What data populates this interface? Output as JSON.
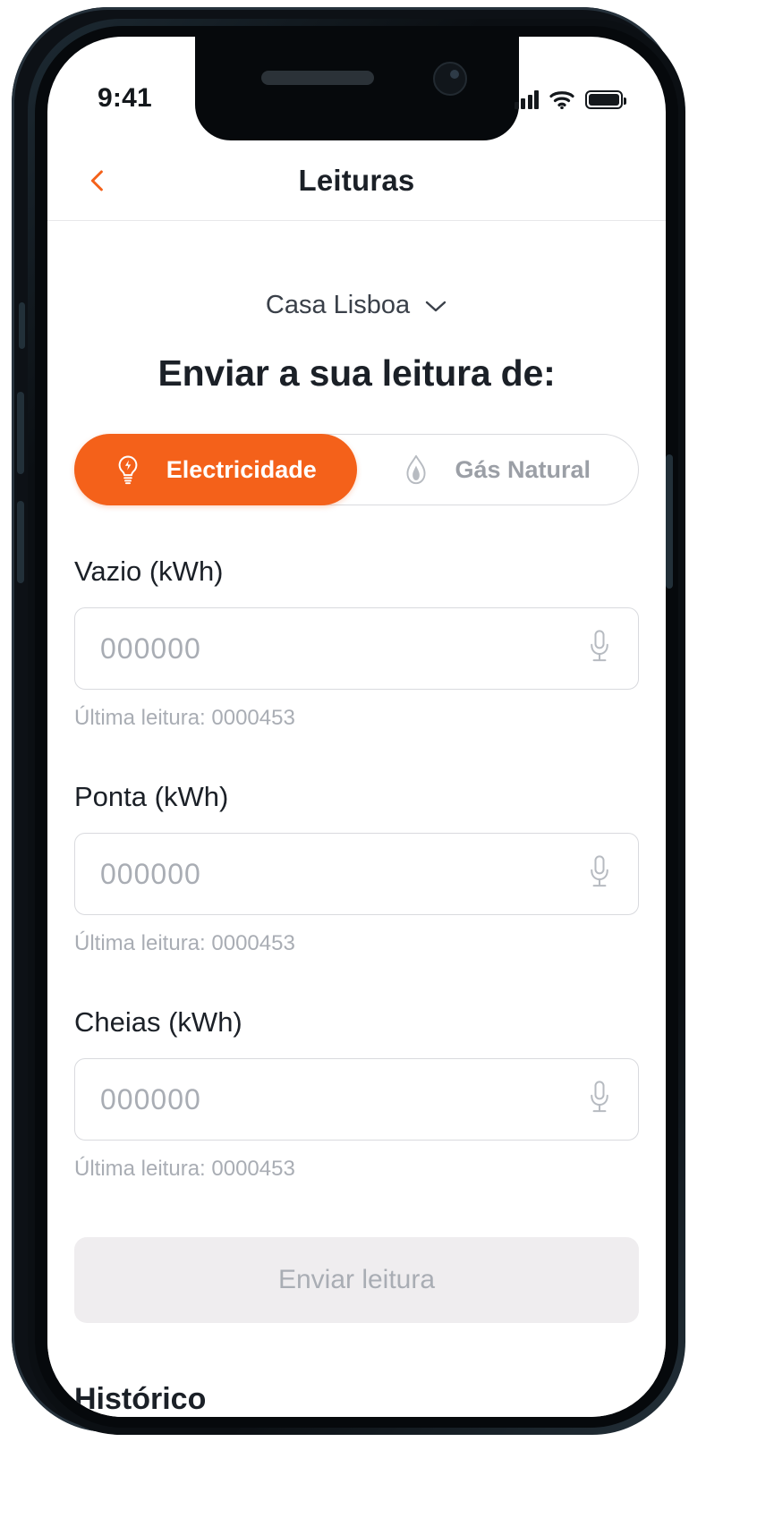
{
  "status_bar": {
    "time": "9:41",
    "signal_icon": "cellular-signal-icon",
    "wifi_icon": "wifi-icon",
    "battery_icon": "battery-icon"
  },
  "nav": {
    "back_icon": "chevron-left-icon",
    "title": "Leituras"
  },
  "house_selector": {
    "label": "Casa Lisboa",
    "chevron_icon": "chevron-down-icon"
  },
  "heading": "Enviar a sua leitura de:",
  "tabs": [
    {
      "label": "Electricidade",
      "icon": "lightbulb-bolt-icon",
      "active": true
    },
    {
      "label": "Gás Natural",
      "icon": "flame-icon",
      "active": false
    }
  ],
  "fields": [
    {
      "label": "Vazio (kWh)",
      "value": "",
      "placeholder": "000000",
      "mic_icon": "microphone-icon",
      "hint": "Última leitura: 0000453"
    },
    {
      "label": "Ponta (kWh)",
      "value": "",
      "placeholder": "000000",
      "mic_icon": "microphone-icon",
      "hint": "Última leitura: 0000453"
    },
    {
      "label": "Cheias (kWh)",
      "value": "",
      "placeholder": "000000",
      "mic_icon": "microphone-icon",
      "hint": "Última leitura: 0000453"
    }
  ],
  "submit": {
    "label": "Enviar leitura",
    "enabled": false
  },
  "history_heading": "Histórico",
  "colors": {
    "accent": "#F4611A",
    "text": "#1b2027",
    "muted": "#a9adb4",
    "border": "#d9dade",
    "disabled_bg": "#EFEDEF"
  }
}
